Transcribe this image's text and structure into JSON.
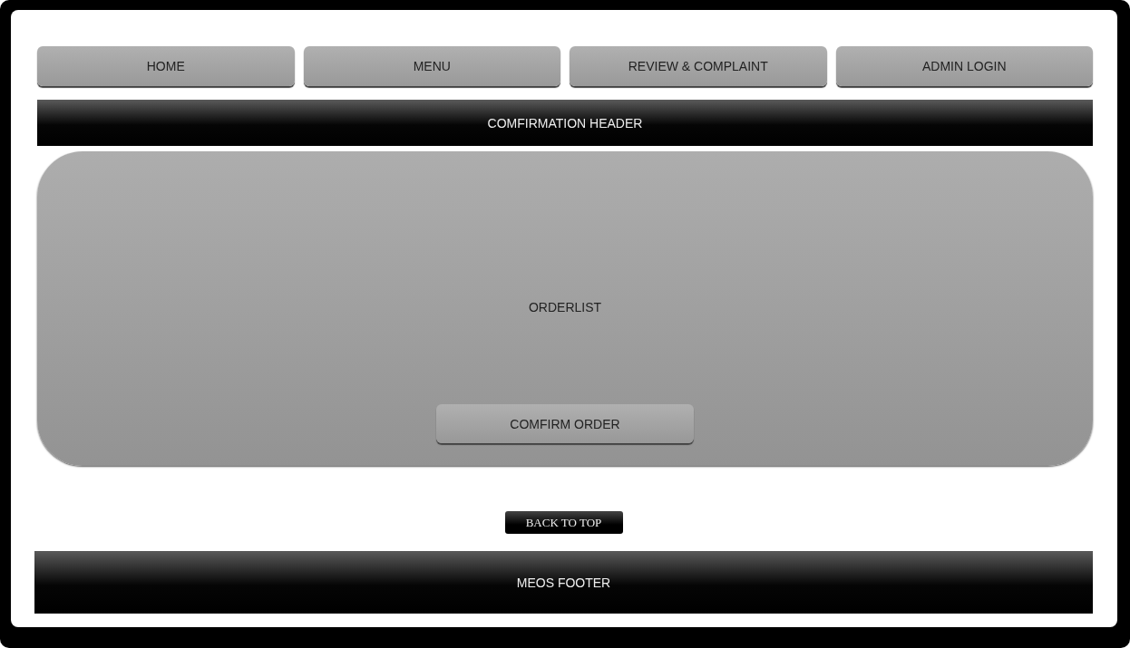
{
  "nav": [
    {
      "label": "HOME"
    },
    {
      "label": "MENU"
    },
    {
      "label": "REVIEW & COMPLAINT"
    },
    {
      "label": "ADMIN LOGIN"
    }
  ],
  "header": {
    "title": "COMFIRMATION HEADER"
  },
  "orderlist": {
    "label": "ORDERLIST",
    "button": "COMFIRM ORDER"
  },
  "back_to_top": "BACK TO TOP",
  "footer": {
    "title": "MEOS FOOTER"
  }
}
